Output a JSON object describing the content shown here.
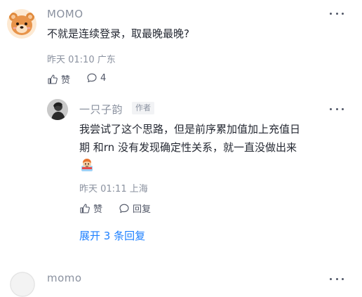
{
  "comment": {
    "username": "MOMO",
    "text": "不就是连续登录，取最晚最晚?",
    "time": "昨天 01:10",
    "location": "广东",
    "like_label": "赞",
    "reply_count": "4"
  },
  "reply": {
    "username": "一只子韵",
    "badge": "作者",
    "text_line1": "我尝试了这个思路，但是前序累加值加上充值日",
    "text_line2": "期 和rn 没有发现确定性关系，就一直没做出来",
    "time": "昨天 01:11",
    "location": "上海",
    "like_label": "赞",
    "reply_label": "回复"
  },
  "expand_replies": "展开 3 条回复",
  "next_comment": {
    "username": "momo"
  },
  "colors": {
    "accent": "#1e80ff",
    "meta_gray": "#8a919f",
    "text": "#252933"
  },
  "icons": {
    "like": "thumbs-up-icon",
    "comment": "comment-bubble-icon",
    "more": "more-dots-icon"
  }
}
